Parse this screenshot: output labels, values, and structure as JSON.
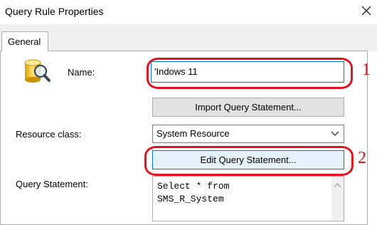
{
  "window": {
    "title": "Query Rule Properties",
    "close_icon": "close-icon"
  },
  "tabs": [
    {
      "label": "General"
    }
  ],
  "form": {
    "name_label": "Name:",
    "name_value": "'Indows 11",
    "import_button_label": "Import Query Statement...",
    "resource_class_label": "Resource class:",
    "resource_class_value": "System Resource",
    "edit_button_label": "Edit Query Statement...",
    "query_statement_label": "Query Statement:",
    "query_lines": [
      "Select * from",
      "SMS_R_System"
    ]
  },
  "annotations": {
    "markers": [
      "1",
      "2"
    ],
    "highlight_color": "#e0141e"
  },
  "icons": {
    "query_icon": "database-magnifier-icon",
    "dropdown_icon": "chevron-down-icon",
    "scroll_up_icon": "scroll-up-arrow-icon"
  }
}
